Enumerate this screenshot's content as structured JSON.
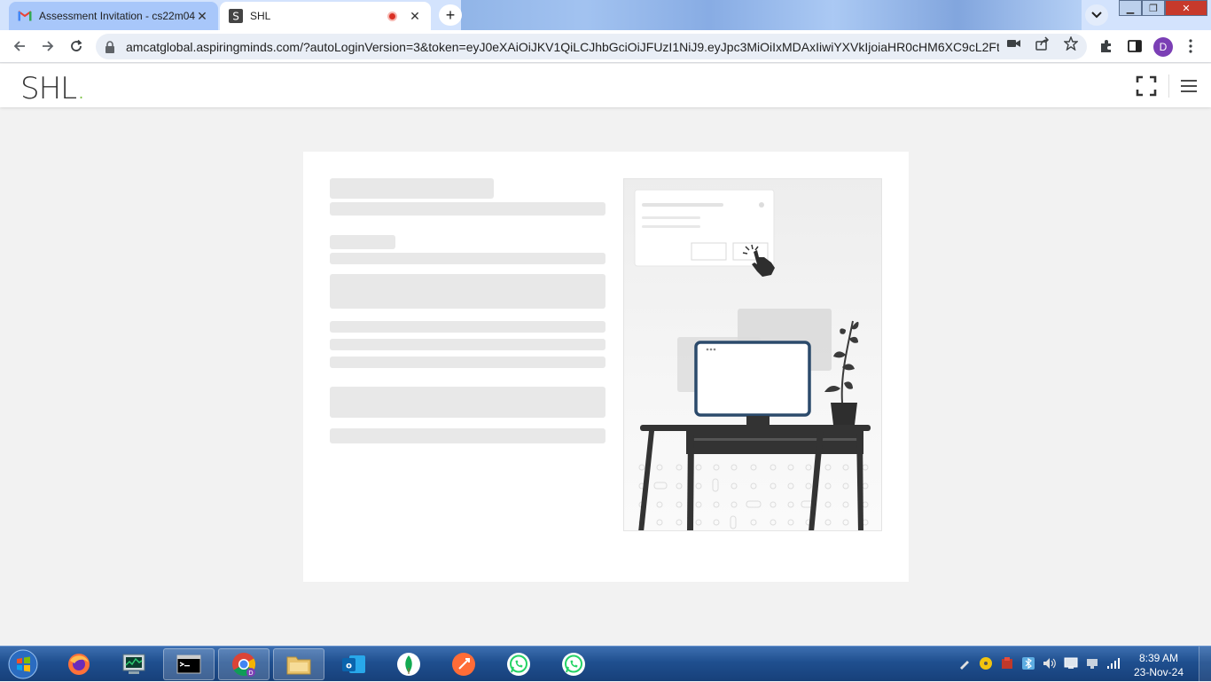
{
  "browser": {
    "tabs": [
      {
        "title": "Assessment Invitation - cs22m04",
        "favicon": "gmail-icon",
        "active": false
      },
      {
        "title": "SHL",
        "favicon": "shl-icon",
        "active": true
      }
    ],
    "url": "amcatglobal.aspiringminds.com/?autoLoginVersion=3&token=eyJ0eXAiOiJKV1QiLCJhbGciOiJFUzI1NiJ9.eyJpc3MiOiIxMDAxIiwiYXVkIjoiaHR0cHM6XC9cL2FtY2...",
    "profile_initial": "D",
    "close_glyph": "✕",
    "new_tab_glyph": "+"
  },
  "header": {
    "logo_text": "SHL",
    "logo_dot": "."
  },
  "taskbar": {
    "time": "8:39 AM",
    "date": "23-Nov-24"
  },
  "colors": {
    "brand_accent": "#7ac143",
    "monitor_frame": "#2b4a6b",
    "skeleton": "#e8e8e8"
  }
}
